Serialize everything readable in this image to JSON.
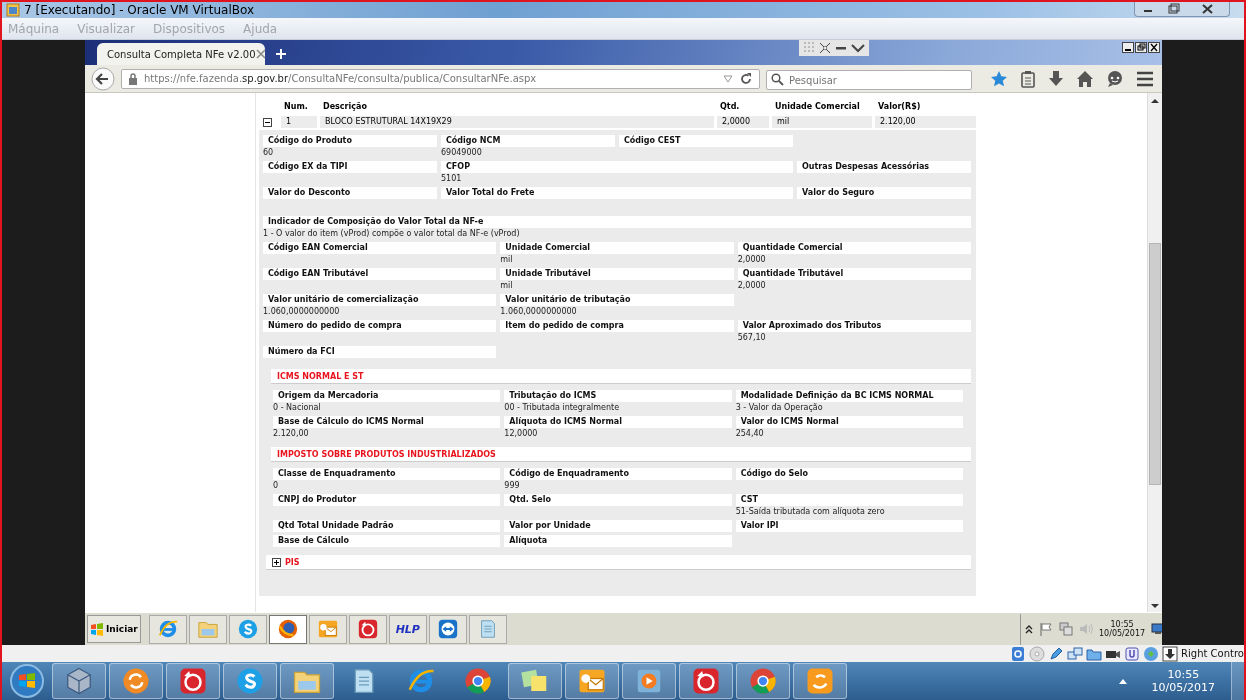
{
  "window": {
    "title": "7 [Executando] - Oracle VM VirtualBox"
  },
  "menu": [
    "Máquina",
    "Visualizar",
    "Dispositivos",
    "Ajuda"
  ],
  "browser": {
    "tab": {
      "label": "Consulta Completa NFe v2.00",
      "selected": true
    },
    "url": "https://nfe.fazenda.**sp.gov.br**/ConsultaNFe/consulta/publica/ConsultarNFe.aspx",
    "search": {
      "placeholder": "Pesquisar"
    }
  },
  "item_table": {
    "columns": [
      "Num.",
      "Descrição",
      "Qtd.",
      "Unidade Comercial",
      "Valor(R$)"
    ],
    "rows": [
      {
        "expanded": true,
        "cells": [
          "1",
          "BLOCO ESTRUTURAL 14X19X29",
          "2,0000",
          "mil",
          "2.120,00"
        ]
      }
    ]
  },
  "detail": [
    {
      "kind": "quad",
      "rows": [
        [
          {
            "label": "Código do Produto",
            "value": "60"
          },
          {
            "label": "Código NCM",
            "value": "69049000"
          },
          {
            "label": "Código CEST"
          }
        ],
        [
          {
            "label": "Código EX da TIPI"
          },
          {
            "label": "CFOP",
            "value": "5101"
          },
          {
            "label": "Outras Despesas Acessórias"
          }
        ],
        [
          {
            "label": "Valor do Desconto"
          },
          {
            "label": "Valor Total do Frete"
          },
          {
            "label": "Valor do Seguro"
          }
        ]
      ]
    },
    {
      "kind": "full",
      "rows": [
        [
          {
            "label": "Indicador de Composição do Valor Total da NF-e",
            "value": "1 - O valor do item (vProd) compõe o valor total da NF-e (vProd)"
          }
        ]
      ]
    },
    {
      "kind": "triple",
      "rows": [
        [
          {
            "label": "Código EAN Comercial"
          },
          {
            "label": "Unidade Comercial",
            "value": "mil"
          },
          {
            "label": "Quantidade Comercial",
            "value": "2,0000"
          }
        ],
        [
          {
            "label": "Código EAN Tributável"
          },
          {
            "label": "Unidade Tributável",
            "value": "mil"
          },
          {
            "label": "Quantidade Tributável",
            "value": "2,0000"
          }
        ],
        [
          {
            "label": "Valor unitário de comercialização",
            "value": "1.060,0000000000"
          },
          {
            "label": "Valor unitário de tributação",
            "value": "1.060,0000000000"
          }
        ],
        [
          {
            "label": "Número do pedido de compra"
          },
          {
            "label": "Item do pedido de compra"
          },
          {
            "label": "Valor Aproximado dos Tributos",
            "value": "567,10"
          }
        ],
        [
          {
            "label": "Número da FCI"
          }
        ]
      ]
    }
  ],
  "sections": [
    {
      "title": "ICMS NORMAL E ST",
      "rows": [
        [
          {
            "label": "Origem da Mercadoria",
            "value": "0 - Nacional"
          },
          {
            "label": "Tributação do ICMS",
            "value": "00 - Tributada integralmente"
          },
          {
            "label": "Modalidade Definição da BC ICMS NORMAL",
            "value": "3 - Valor da Operação"
          }
        ],
        [
          {
            "label": "Base de Cálculo do ICMS Normal",
            "value": "2.120,00"
          },
          {
            "label": "Alíquota do ICMS Normal",
            "value": "12,0000"
          },
          {
            "label": "Valor do ICMS Normal",
            "value": "254,40"
          }
        ]
      ]
    },
    {
      "title": "IMPOSTO SOBRE PRODUTOS INDUSTRIALIZADOS",
      "rows": [
        [
          {
            "label": "Classe de Enquadramento",
            "value": "0"
          },
          {
            "label": "Código de Enquadramento",
            "value": "999"
          },
          {
            "label": "Código do Selo"
          }
        ],
        [
          {
            "label": "CNPJ do Produtor"
          },
          {
            "label": "Qtd. Selo"
          },
          {
            "label": "CST",
            "value": "51-Saída tributada com alíquota zero"
          }
        ],
        [
          {
            "label": "Qtd Total Unidade Padrão"
          },
          {
            "label": "Valor por Unidade"
          },
          {
            "label": "Valor IPI"
          }
        ],
        [
          {
            "label": "Base de Cálculo"
          },
          {
            "label": "Alíquota"
          }
        ]
      ]
    },
    {
      "title": "PIS",
      "expanded": false
    }
  ],
  "guest_taskbar": {
    "start": "Iniciar",
    "apps": [
      {
        "kind": "ie",
        "selected": false
      },
      {
        "kind": "folder",
        "selected": false
      },
      {
        "kind": "skype",
        "selected": false
      },
      {
        "kind": "firefox",
        "selected": true
      },
      {
        "kind": "outlook",
        "selected": false
      },
      {
        "kind": "globe",
        "selected": false
      },
      {
        "kind": "hlp",
        "label": "HLP",
        "selected": false
      },
      {
        "kind": "teamviewer",
        "selected": false
      },
      {
        "kind": "notepad",
        "selected": false
      }
    ],
    "clock": {
      "time": "10:55",
      "date": "10/05/2017"
    }
  },
  "vb_status": {
    "label": "Right Contro"
  },
  "host_taskbar": {
    "apps": [
      {
        "kind": "virtualbox",
        "running": true
      },
      {
        "kind": "sync",
        "running": true
      },
      {
        "kind": "globe",
        "running": true
      },
      {
        "kind": "skype",
        "running": true
      },
      {
        "kind": "folder",
        "running": true
      },
      {
        "kind": "notepad",
        "running": false
      },
      {
        "kind": "ie",
        "running": false
      },
      {
        "kind": "chrome",
        "running": false
      },
      {
        "kind": "notes",
        "running": true
      },
      {
        "kind": "outlook",
        "running": true
      },
      {
        "kind": "media",
        "running": true
      },
      {
        "kind": "globe",
        "running": true
      },
      {
        "kind": "chrome",
        "running": true
      },
      {
        "kind": "uc",
        "running": true
      }
    ],
    "clock": {
      "time": "10:55",
      "date": "10/05/2017"
    }
  }
}
